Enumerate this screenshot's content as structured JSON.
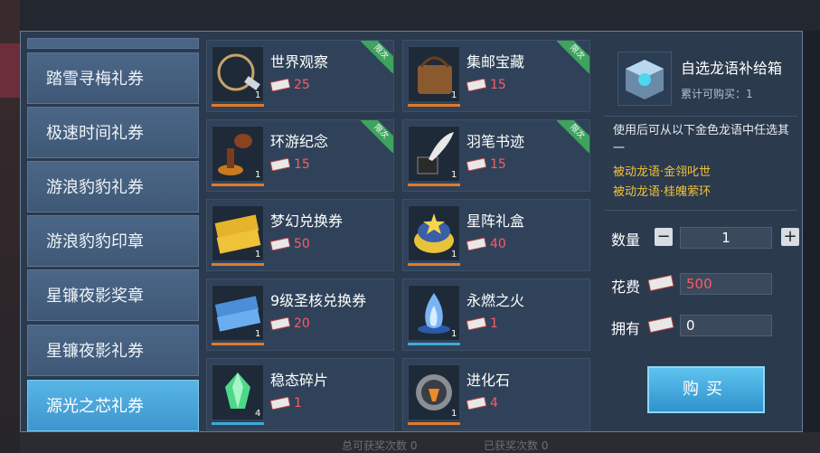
{
  "tabs": [
    {
      "label": "踏雪寻梅礼券"
    },
    {
      "label": "极速时间礼券"
    },
    {
      "label": "游浪豹豹礼券"
    },
    {
      "label": "游浪豹豹印章"
    },
    {
      "label": "星镰夜影奖章"
    },
    {
      "label": "星镰夜影礼券"
    },
    {
      "label": "源光之芯礼券",
      "active": true
    }
  ],
  "items": [
    {
      "name": "世界观察",
      "price": "25",
      "qty": "1",
      "limited": true
    },
    {
      "name": "集邮宝藏",
      "price": "15",
      "qty": "1",
      "limited": true
    },
    {
      "name": "环游纪念",
      "price": "15",
      "qty": "1",
      "limited": true
    },
    {
      "name": "羽笔书迹",
      "price": "15",
      "qty": "1",
      "limited": true
    },
    {
      "name": "梦幻兑换券",
      "price": "50",
      "qty": "1",
      "limited": false
    },
    {
      "name": "星阵礼盒",
      "price": "40",
      "qty": "1",
      "limited": false
    },
    {
      "name": "9级圣核兑换券",
      "price": "20",
      "qty": "1",
      "limited": false
    },
    {
      "name": "永燃之火",
      "price": "1",
      "qty": "1",
      "limited": false
    },
    {
      "name": "稳态碎片",
      "price": "1",
      "qty": "4",
      "limited": false
    },
    {
      "name": "进化石",
      "price": "4",
      "qty": "1",
      "limited": false
    }
  ],
  "limited_label": "限次",
  "detail": {
    "title": "自选龙语补给箱",
    "limit": "累计可购买：1",
    "desc": "使用后可从以下金色龙语中任选其一",
    "options": [
      "被动龙语·金翎叱世",
      "被动龙语·桂魄萦环"
    ],
    "qty_label": "数量",
    "qty_value": "1",
    "cost_label": "花费",
    "cost_value": "500",
    "own_label": "拥有",
    "own_value": "0",
    "buy_label": "购买"
  },
  "bg_bottom": {
    "left_text": "总可获奖次数 0",
    "right_text": "已获奖次数 0"
  },
  "colors": {
    "price_red": "#ff5a66",
    "option_gold": "#f2c23a",
    "active_tab": "#4aa7dc"
  }
}
